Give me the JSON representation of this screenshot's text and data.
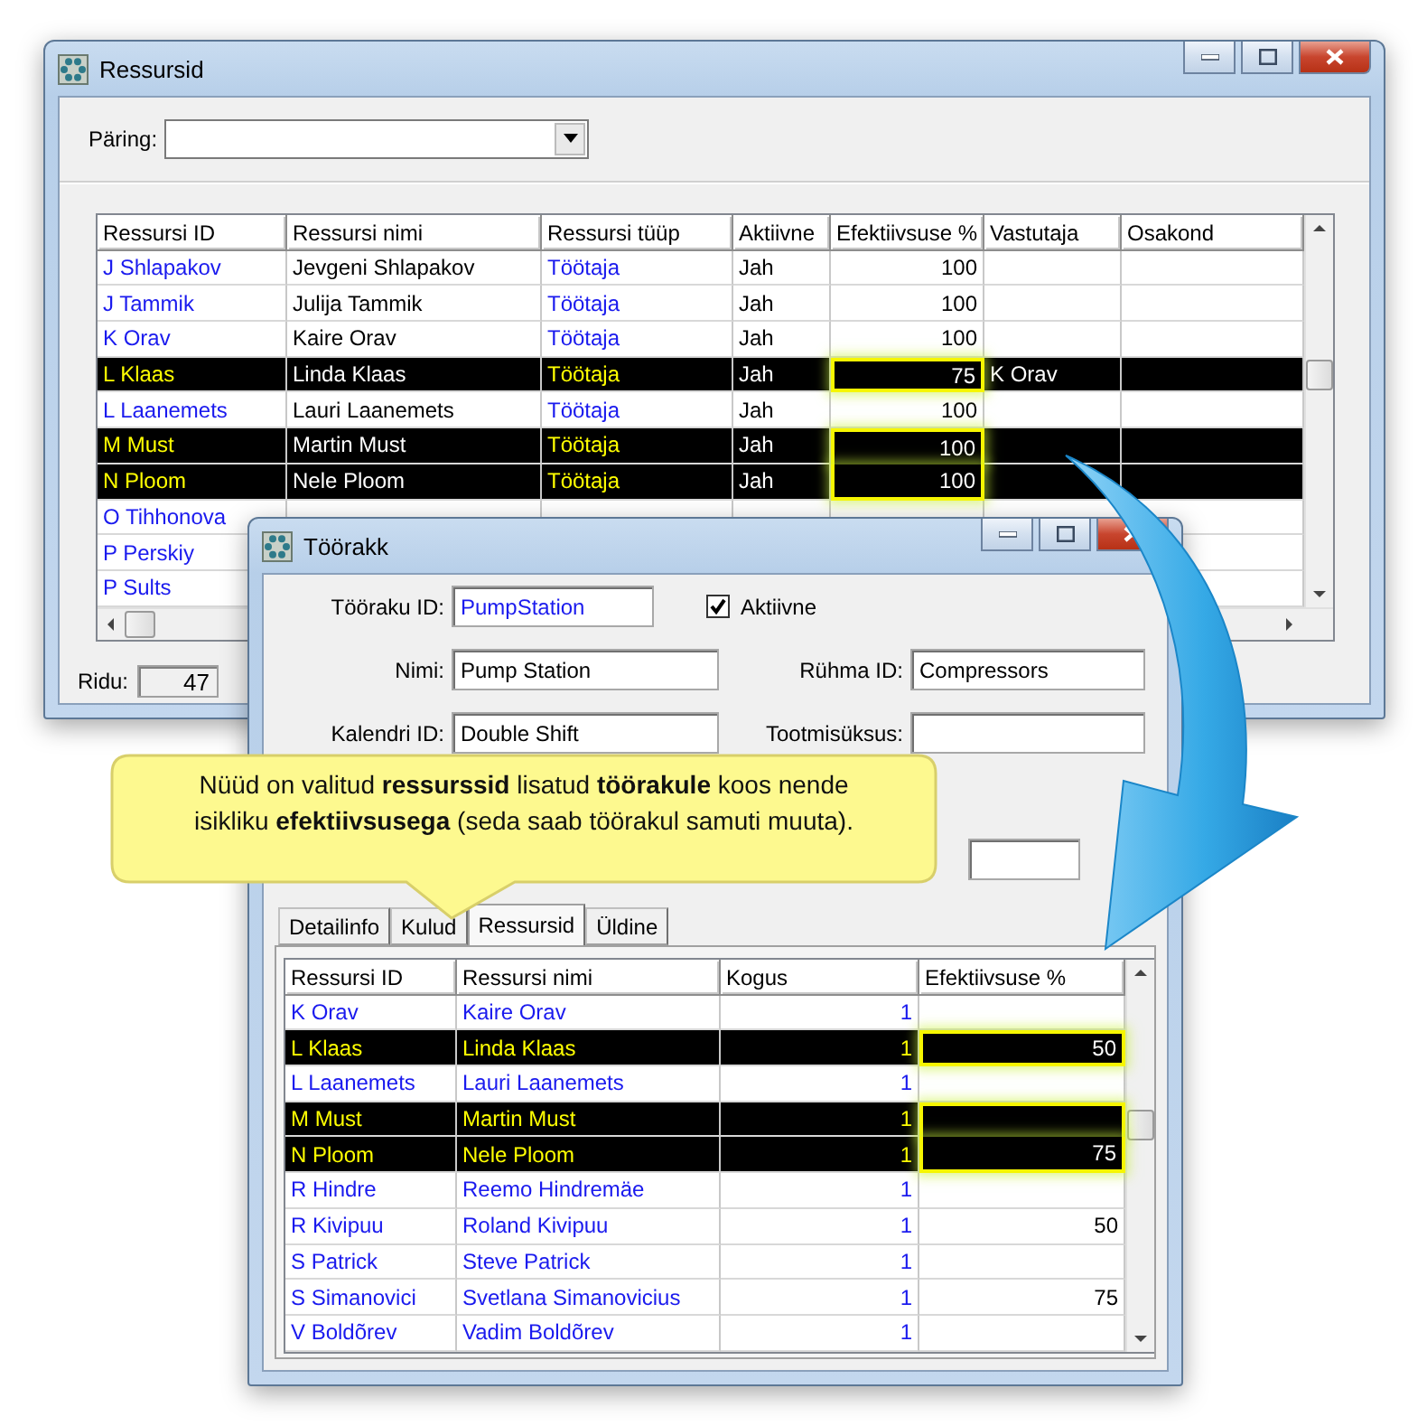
{
  "resources_window": {
    "title": "Ressursid",
    "query": {
      "label": "Päring:"
    },
    "grid": {
      "columns": [
        {
          "label": "Ressursi ID",
          "kind": "link"
        },
        {
          "label": "Ressursi nimi",
          "kind": "text"
        },
        {
          "label": "Ressursi tüüp",
          "kind": "link"
        },
        {
          "label": "Aktiivne",
          "kind": "text"
        },
        {
          "label": "Efektiivsuse %",
          "kind": "number"
        },
        {
          "label": "Vastutaja",
          "kind": "text"
        },
        {
          "label": "Osakond",
          "kind": "text"
        }
      ],
      "rows": [
        {
          "cells": [
            "J Shlapakov",
            "Jevgeni Shlapakov",
            "Töötaja",
            "Jah",
            "100"
          ],
          "selected": false
        },
        {
          "cells": [
            "J Tammik",
            "Julija Tammik",
            "Töötaja",
            "Jah",
            "100"
          ],
          "selected": false
        },
        {
          "cells": [
            "K Orav",
            "Kaire Orav",
            "Töötaja",
            "Jah",
            "100"
          ],
          "selected": false
        },
        {
          "cells": [
            "L Klaas",
            "Linda Klaas",
            "Töötaja",
            "Jah",
            "75",
            "K Orav"
          ],
          "selected": true
        },
        {
          "cells": [
            "L Laanemets",
            "Lauri Laanemets",
            "Töötaja",
            "Jah",
            "100"
          ],
          "selected": false
        },
        {
          "cells": [
            "M Must",
            "Martin Must",
            "Töötaja",
            "Jah",
            "100"
          ],
          "selected": true
        },
        {
          "cells": [
            "N Ploom",
            "Nele Ploom",
            "Töötaja",
            "Jah",
            "100"
          ],
          "selected": true
        },
        {
          "cells": [
            "O Tihhonova"
          ],
          "selected": false
        },
        {
          "cells": [
            "P Perskiy"
          ],
          "selected": false
        },
        {
          "cells": [
            "P Sults"
          ],
          "selected": false
        }
      ]
    },
    "status": {
      "label": "Ridu:",
      "value": "47"
    }
  },
  "work_center_window": {
    "title": "Töörakk",
    "id_field": {
      "label": "Tööraku ID:",
      "value": "PumpStation"
    },
    "active": {
      "label": "Aktiivne",
      "checked": true
    },
    "fields": [
      {
        "label": "Nimi:",
        "value": "Pump Station"
      },
      {
        "label": "Rühma ID:",
        "value": "Compressors"
      },
      {
        "label": "Kalendri ID:",
        "value": "Double Shift"
      },
      {
        "label": "Tootmisüksus:"
      }
    ],
    "tabs": [
      {
        "label": "Detailinfo",
        "selected": false
      },
      {
        "label": "Kulud",
        "selected": false
      },
      {
        "label": "Ressursid",
        "selected": true
      },
      {
        "label": "Üldine",
        "selected": false
      }
    ],
    "grid": {
      "columns": [
        {
          "label": "Ressursi ID",
          "kind": "link"
        },
        {
          "label": "Ressursi nimi",
          "kind": "link"
        },
        {
          "label": "Kogus",
          "kind": "link_number"
        },
        {
          "label": "Efektiivsuse %",
          "kind": "number"
        }
      ],
      "rows": [
        {
          "cells": [
            "K Orav",
            "Kaire Orav",
            "1"
          ],
          "selected": false
        },
        {
          "cells": [
            "L Klaas",
            "Linda Klaas",
            "1",
            "50"
          ],
          "selected": true
        },
        {
          "cells": [
            "L Laanemets",
            "Lauri Laanemets",
            "1"
          ],
          "selected": false
        },
        {
          "cells": [
            "M Must",
            "Martin Must",
            "1"
          ],
          "selected": true
        },
        {
          "cells": [
            "N Ploom",
            "Nele Ploom",
            "1",
            "75"
          ],
          "selected": true
        },
        {
          "cells": [
            "R Hindre",
            "Reemo Hindremäe",
            "1"
          ],
          "selected": false
        },
        {
          "cells": [
            "R Kivipuu",
            "Roland Kivipuu",
            "1",
            "50"
          ],
          "selected": false
        },
        {
          "cells": [
            "S Patrick",
            "Steve Patrick",
            "1"
          ],
          "selected": false
        },
        {
          "cells": [
            "S Simanovici",
            "Svetlana Simanovicius",
            "1",
            "75"
          ],
          "selected": false
        },
        {
          "cells": [
            "V Boldõrev",
            "Vadim Boldõrev",
            "1"
          ],
          "selected": false
        }
      ]
    }
  },
  "callout": {
    "text": "Nüüd on valitud **ressurssid** lisatud **töörakule** koos nende isikliku **efektiivsusega** (seda saab töörakul samuti muuta)."
  }
}
